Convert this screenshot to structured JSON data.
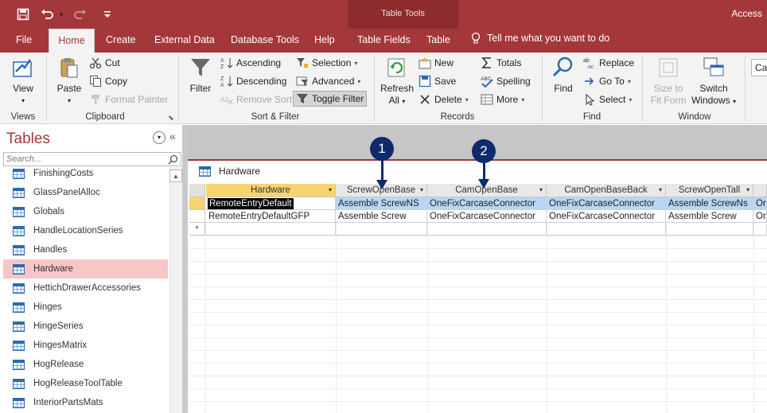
{
  "title_bar": {
    "context_group": "Table Tools",
    "app_name": "Access"
  },
  "quick_access": [
    {
      "icon": "save-icon"
    },
    {
      "icon": "undo-icon"
    },
    {
      "icon": "redo-icon"
    },
    {
      "icon": "customize-icon"
    }
  ],
  "tabs": [
    "File",
    "Home",
    "Create",
    "External Data",
    "Database Tools",
    "Help",
    "Table Fields",
    "Table"
  ],
  "tell_me": "Tell me what you want to do",
  "ribbon": {
    "views": {
      "view": "View",
      "group": "Views"
    },
    "clipboard": {
      "paste": "Paste",
      "cut": "Cut",
      "copy": "Copy",
      "format_painter": "Format Painter",
      "group": "Clipboard"
    },
    "sort_filter": {
      "filter": "Filter",
      "ascending": "Ascending",
      "descending": "Descending",
      "remove_sort": "Remove Sort",
      "selection": "Selection",
      "advanced": "Advanced",
      "toggle_filter": "Toggle Filter",
      "group": "Sort & Filter"
    },
    "records": {
      "refresh_1": "Refresh",
      "refresh_2": "All",
      "new": "New",
      "save": "Save",
      "delete": "Delete",
      "totals": "Totals",
      "spelling": "Spelling",
      "more": "More",
      "group": "Records"
    },
    "find": {
      "find": "Find",
      "replace": "Replace",
      "goto": "Go To",
      "select": "Select",
      "group": "Find"
    },
    "window": {
      "size_1": "Size to",
      "size_2": "Fit Form",
      "switch_1": "Switch",
      "switch_2": "Windows",
      "group": "Window"
    },
    "font_box": "Ca"
  },
  "nav": {
    "title": "Tables",
    "search_placeholder": "Search...",
    "items": [
      {
        "label": "FinishingCosts",
        "selected": false
      },
      {
        "label": "GlassPanelAlloc",
        "selected": false
      },
      {
        "label": "Globals",
        "selected": false
      },
      {
        "label": "HandleLocationSeries",
        "selected": false
      },
      {
        "label": "Handles",
        "selected": false
      },
      {
        "label": "Hardware",
        "selected": true
      },
      {
        "label": "HettichDrawerAccessories",
        "selected": false
      },
      {
        "label": "Hinges",
        "selected": false
      },
      {
        "label": "HingeSeries",
        "selected": false
      },
      {
        "label": "HingesMatrix",
        "selected": false
      },
      {
        "label": "HogRelease",
        "selected": false
      },
      {
        "label": "HogReleaseToolTable",
        "selected": false
      },
      {
        "label": "InteriorPartsMats",
        "selected": false
      }
    ]
  },
  "document": {
    "tab_title": "Hardware",
    "columns": [
      "Hardware",
      "ScrewOpenBase",
      "CamOpenBase",
      "CamOpenBaseBack",
      "ScrewOpenTall"
    ],
    "rows": [
      [
        "RemoteEntryDefault",
        "Assemble ScrewNS",
        "OneFixCarcaseConnector",
        "OneFixCarcaseConnector",
        "Assemble ScrewNs",
        "On"
      ],
      [
        "RemoteEntryDefaultGFP",
        "Assemble Screw",
        "OneFixCarcaseConnector",
        "OneFixCarcaseConnector",
        "Assemble Screw",
        "On"
      ]
    ],
    "new_row_marker": "*"
  },
  "callouts": [
    "1",
    "2"
  ]
}
